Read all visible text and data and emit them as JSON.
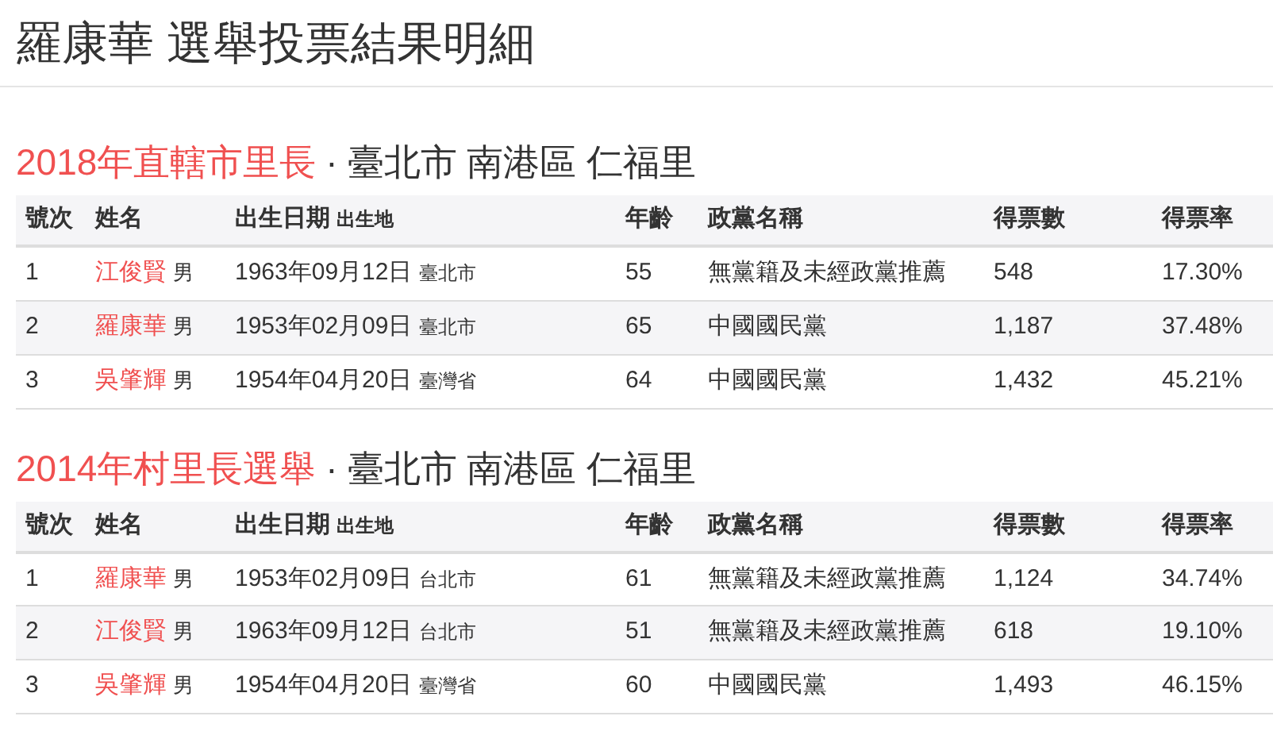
{
  "page_title": "羅康華 選舉投票結果明細",
  "sections": [
    {
      "election": "2018年直轄市里長",
      "separator": "·",
      "region": "臺北市 南港區 仁福里",
      "columns": [
        "號次",
        "姓名",
        "出生日期",
        "出生地",
        "年齡",
        "政黨名稱",
        "得票數",
        "得票率"
      ],
      "rows": [
        {
          "number": "1",
          "name": "江俊賢",
          "gender": "男",
          "birth_date": "1963年09月12日",
          "birthplace": "臺北市",
          "age": "55",
          "party": "無黨籍及未經政黨推薦",
          "votes": "548",
          "rate": "17.30%"
        },
        {
          "number": "2",
          "name": "羅康華",
          "gender": "男",
          "birth_date": "1953年02月09日",
          "birthplace": "臺北市",
          "age": "65",
          "party": "中國國民黨",
          "votes": "1,187",
          "rate": "37.48%"
        },
        {
          "number": "3",
          "name": "吳肇輝",
          "gender": "男",
          "birth_date": "1954年04月20日",
          "birthplace": "臺灣省",
          "age": "64",
          "party": "中國國民黨",
          "votes": "1,432",
          "rate": "45.21%"
        }
      ]
    },
    {
      "election": "2014年村里長選舉",
      "separator": "·",
      "region": "臺北市 南港區 仁福里",
      "columns": [
        "號次",
        "姓名",
        "出生日期",
        "出生地",
        "年齡",
        "政黨名稱",
        "得票數",
        "得票率"
      ],
      "rows": [
        {
          "number": "1",
          "name": "羅康華",
          "gender": "男",
          "birth_date": "1953年02月09日",
          "birthplace": "台北市",
          "age": "61",
          "party": "無黨籍及未經政黨推薦",
          "votes": "1,124",
          "rate": "34.74%"
        },
        {
          "number": "2",
          "name": "江俊賢",
          "gender": "男",
          "birth_date": "1963年09月12日",
          "birthplace": "台北市",
          "age": "51",
          "party": "無黨籍及未經政黨推薦",
          "votes": "618",
          "rate": "19.10%"
        },
        {
          "number": "3",
          "name": "吳肇輝",
          "gender": "男",
          "birth_date": "1954年04月20日",
          "birthplace": "臺灣省",
          "age": "60",
          "party": "中國國民黨",
          "votes": "1,493",
          "rate": "46.15%"
        }
      ]
    }
  ]
}
